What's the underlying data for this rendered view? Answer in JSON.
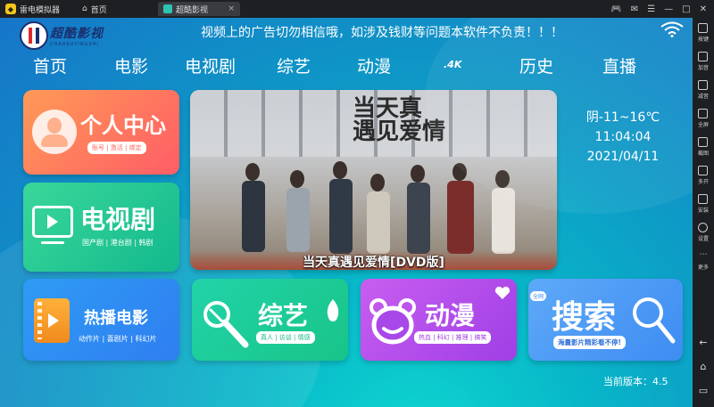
{
  "window": {
    "app_name": "雷电模拟器",
    "home_tab": "首页",
    "active_tab": "超酷影视",
    "close_glyph": "×"
  },
  "sidebar": {
    "items": [
      {
        "label": "按键",
        "icon": "keyboard-icon"
      },
      {
        "label": "加音",
        "icon": "volume-up-icon"
      },
      {
        "label": "减音",
        "icon": "volume-down-icon"
      },
      {
        "label": "全屏",
        "icon": "fullscreen-icon"
      },
      {
        "label": "截图",
        "icon": "scissors-icon"
      },
      {
        "label": "多开",
        "icon": "multi-instance-icon"
      },
      {
        "label": "安装",
        "icon": "apk-icon"
      },
      {
        "label": "设置",
        "icon": "gear-icon"
      },
      {
        "label": "更多",
        "icon": "more-icon"
      }
    ],
    "nav_back": "←",
    "nav_home": "⌂",
    "nav_recent": "▭"
  },
  "brand": {
    "cn": "超酷影视",
    "en": "CHAOKUYINGSHI"
  },
  "notice": "视频上的广告切勿相信哦，如涉及钱财等问题本软件不负责！！！",
  "nav": {
    "items": [
      "首页",
      "电影",
      "电视剧",
      "综艺",
      "动漫",
      ".4K",
      "历史",
      "直播"
    ]
  },
  "tiles": {
    "profile": {
      "title": "个人中心",
      "sub": "账号 | 激活 | 绑定"
    },
    "tv": {
      "title": "电视剧",
      "sub": "国产剧 | 港台剧 | 韩剧"
    },
    "movie": {
      "title": "热播电影",
      "sub": "动作片 | 喜剧片 | 科幻片"
    },
    "variety": {
      "title": "综艺",
      "sub": "真人 | 访谈 | 情感"
    },
    "anime": {
      "title": "动漫",
      "sub": "热血 | 科幻 | 推理 | 搞笑"
    },
    "search": {
      "title": "搜索",
      "badge": "全网",
      "sub": "海量影片精彩看不停!"
    }
  },
  "banner": {
    "poster_title_line1": "当天真",
    "poster_title_line2": "遇见爱情",
    "caption": "当天真遇见爱情[DVD版]"
  },
  "weather": {
    "forecast": "阴-11~16℃",
    "time": "11:04:04",
    "date": "2021/04/11"
  },
  "version": "当前版本：4.5",
  "colors": {
    "profile": "#ff7a5c",
    "tv": "#27c994",
    "movie": "#2f8cf3",
    "variety": "#1ecb9a",
    "anime": "#b54eeb",
    "search": "#4d9af5",
    "brand_red": "#e02a2a",
    "brand_navy": "#1b2f6e"
  }
}
